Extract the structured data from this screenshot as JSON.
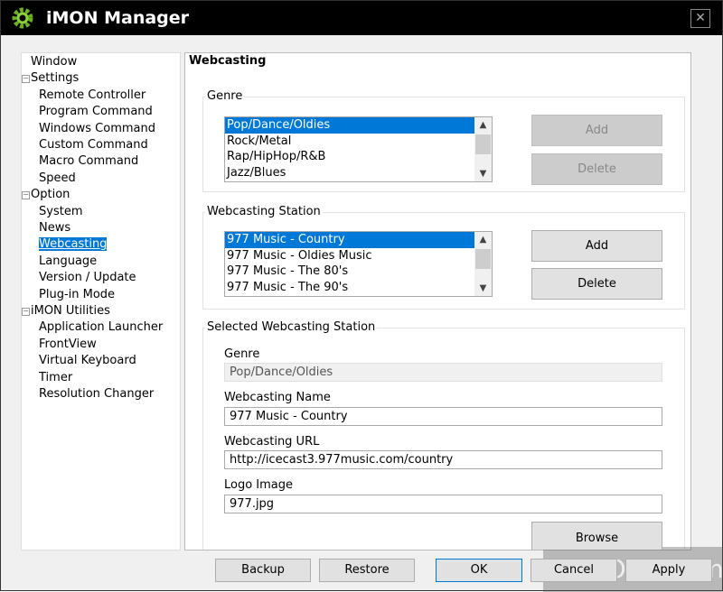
{
  "window": {
    "title": "iMON Manager",
    "close_label": "✕"
  },
  "tree": [
    {
      "label": "Window",
      "level": 0
    },
    {
      "label": "Settings",
      "level": 0,
      "expander": "−"
    },
    {
      "label": "Remote Controller",
      "level": 1
    },
    {
      "label": "Program Command",
      "level": 1
    },
    {
      "label": "Windows Command",
      "level": 1
    },
    {
      "label": "Custom Command",
      "level": 1
    },
    {
      "label": "Macro Command",
      "level": 1
    },
    {
      "label": "Speed",
      "level": 1
    },
    {
      "label": "Option",
      "level": 0,
      "expander": "−"
    },
    {
      "label": "System",
      "level": 1
    },
    {
      "label": "News",
      "level": 1
    },
    {
      "label": "Webcasting",
      "level": 1,
      "selected": true
    },
    {
      "label": "Language",
      "level": 1
    },
    {
      "label": "Version / Update",
      "level": 1
    },
    {
      "label": "Plug-in Mode",
      "level": 1
    },
    {
      "label": "iMON Utilities",
      "level": 0,
      "expander": "−"
    },
    {
      "label": "Application Launcher",
      "level": 1
    },
    {
      "label": "FrontView",
      "level": 1
    },
    {
      "label": "Virtual Keyboard",
      "level": 1
    },
    {
      "label": "Timer",
      "level": 1
    },
    {
      "label": "Resolution Changer",
      "level": 1
    }
  ],
  "panel": {
    "title": "Webcasting",
    "genre": {
      "label": "Genre",
      "items": [
        "Pop/Dance/Oldies",
        "Rock/Metal",
        "Rap/HipHop/R&B",
        "Jazz/Blues"
      ],
      "add": "Add",
      "delete": "Delete"
    },
    "station": {
      "label": "Webcasting Station",
      "items": [
        "977 Music - Country",
        "977 Music - Oldies Music",
        "977 Music - The 80's",
        "977 Music - The 90's"
      ],
      "add": "Add",
      "delete": "Delete"
    },
    "selected": {
      "label": "Selected Webcasting Station",
      "genre_label": "Genre",
      "genre_value": "Pop/Dance/Oldies",
      "name_label": "Webcasting Name",
      "name_value": "977 Music - Country",
      "url_label": "Webcasting URL",
      "url_value": "http://icecast3.977music.com/country",
      "logo_label": "Logo Image",
      "logo_value": "977.jpg",
      "browse": "Browse"
    }
  },
  "footer": {
    "backup": "Backup",
    "restore": "Restore",
    "ok": "OK",
    "cancel": "Cancel",
    "apply": "Apply"
  },
  "watermark": "LO4D.com",
  "colors": {
    "selection": "#0078d7",
    "titlebar": "#000000"
  }
}
